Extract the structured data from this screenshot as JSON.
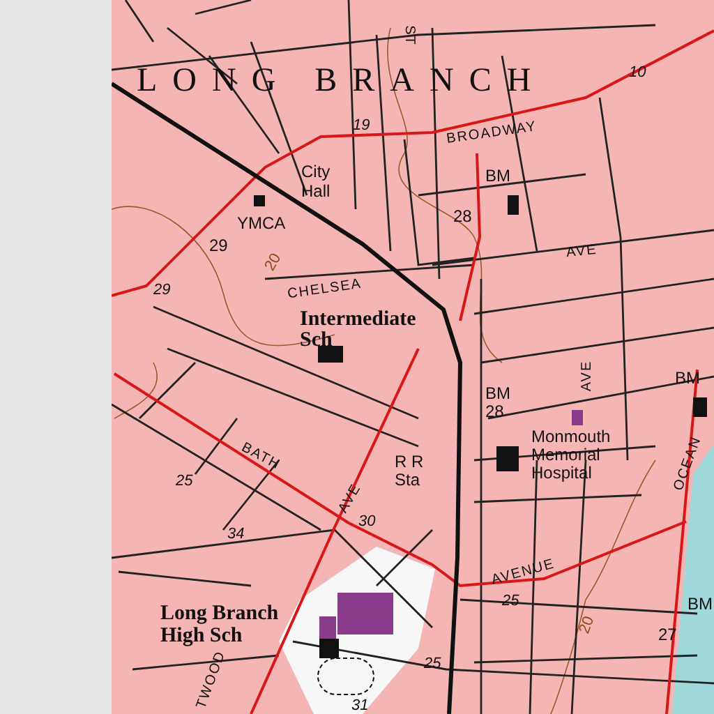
{
  "map": {
    "labels": [
      {
        "text": "LONG BRANCH",
        "kind": "title"
      },
      {
        "text": "ST",
        "kind": "street"
      },
      {
        "text": "10",
        "kind": "elevation"
      },
      {
        "text": "19",
        "kind": "elevation"
      },
      {
        "text": "BROADWAY",
        "kind": "street"
      },
      {
        "text": "BM",
        "kind": "place"
      },
      {
        "text": "City Hall",
        "kind": "place"
      },
      {
        "text": "YMCA",
        "kind": "place"
      },
      {
        "text": "28",
        "kind": "place"
      },
      {
        "text": "29",
        "kind": "place"
      },
      {
        "text": "29",
        "kind": "elevation"
      },
      {
        "text": "AVE",
        "kind": "street"
      },
      {
        "text": "CHELSEA",
        "kind": "street"
      },
      {
        "text": "20",
        "kind": "contour"
      },
      {
        "text": "Intermediate Sch",
        "kind": "institution"
      },
      {
        "text": "BM",
        "kind": "place"
      },
      {
        "text": "28",
        "kind": "place"
      },
      {
        "text": "BM",
        "kind": "place"
      },
      {
        "text": "AVE",
        "kind": "street"
      },
      {
        "text": "R R Sta",
        "kind": "place"
      },
      {
        "text": "Monmouth Memorial Hospital",
        "kind": "place"
      },
      {
        "text": "BATH",
        "kind": "street"
      },
      {
        "text": "AVE",
        "kind": "street"
      },
      {
        "text": "30",
        "kind": "elevation"
      },
      {
        "text": "25",
        "kind": "elevation"
      },
      {
        "text": "34",
        "kind": "elevation"
      },
      {
        "text": "OCEAN",
        "kind": "street"
      },
      {
        "text": "AVENUE",
        "kind": "street"
      },
      {
        "text": "25",
        "kind": "elevation"
      },
      {
        "text": "BM",
        "kind": "place"
      },
      {
        "text": "27",
        "kind": "place"
      },
      {
        "text": "20",
        "kind": "contour"
      },
      {
        "text": "Long Branch High Sch",
        "kind": "institution"
      },
      {
        "text": "25",
        "kind": "elevation"
      },
      {
        "text": "31",
        "kind": "elevation"
      },
      {
        "text": "TWOOD",
        "kind": "street"
      }
    ]
  }
}
